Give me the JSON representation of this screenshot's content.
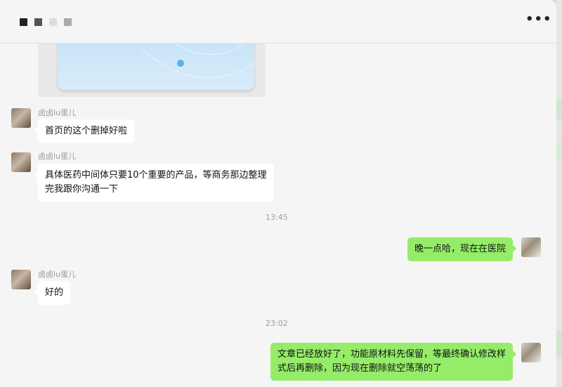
{
  "header": {
    "title_blocks": [
      "#222222",
      "#555555",
      "#dddddd",
      "#aaaaaa"
    ],
    "more_icon": "more-horizontal-icon",
    "more_label": "•••"
  },
  "colors": {
    "incoming_bubble": "#ffffff",
    "outgoing_bubble": "#95ec69",
    "timestamp_text": "#9c9c9c",
    "background": "#f5f5f5"
  },
  "messages": [
    {
      "type": "image",
      "direction": "in"
    },
    {
      "type": "text",
      "direction": "in",
      "sender": "卤卤lu蛋儿",
      "text": "首页的这个删掉好啦"
    },
    {
      "type": "text",
      "direction": "in",
      "sender": "卤卤lu蛋儿",
      "lines": [
        "具体医药中间体只要10个重要的产品，等商务那边整理",
        "完我跟你沟通一下"
      ]
    },
    {
      "type": "time",
      "text": "13:45"
    },
    {
      "type": "text",
      "direction": "out",
      "text": "晚一点哈，现在在医院"
    },
    {
      "type": "text",
      "direction": "in",
      "sender": "卤卤lu蛋儿",
      "text": "好的"
    },
    {
      "type": "time",
      "text": "23:02"
    },
    {
      "type": "text",
      "direction": "out",
      "lines": [
        "文章已经放好了，功能原材料先保留，等最终确认修改样",
        "式后再删除，因为现在删除就空荡荡的了"
      ]
    }
  ]
}
